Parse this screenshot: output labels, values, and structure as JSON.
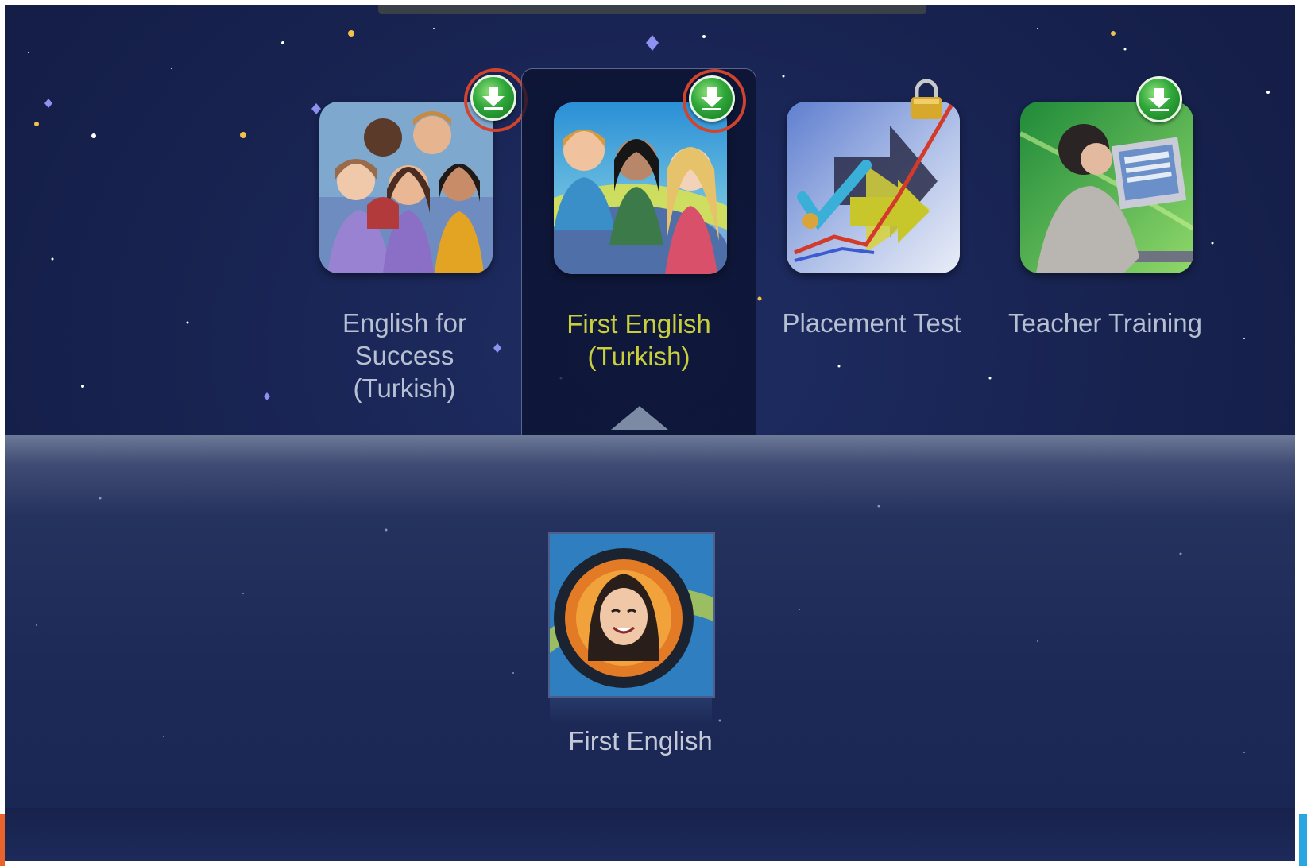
{
  "courses": [
    {
      "label": "English for\nSuccess\n(Turkish)",
      "status_icon": "download-icon",
      "selected": false
    },
    {
      "label": "First English\n(Turkish)",
      "status_icon": "download-icon",
      "selected": true
    },
    {
      "label": "Placement Test",
      "status_icon": "lock-icon",
      "selected": false
    },
    {
      "label": "Teacher Training",
      "status_icon": "download-icon",
      "selected": false
    }
  ],
  "submenu": {
    "items": [
      {
        "label": "First English"
      }
    ]
  },
  "colors": {
    "selected_label": "#c9cf3c",
    "label": "#b7bfd2",
    "download_badge": "#2fa83a",
    "highlight_ring": "#d2432e",
    "background": "#17224f"
  }
}
